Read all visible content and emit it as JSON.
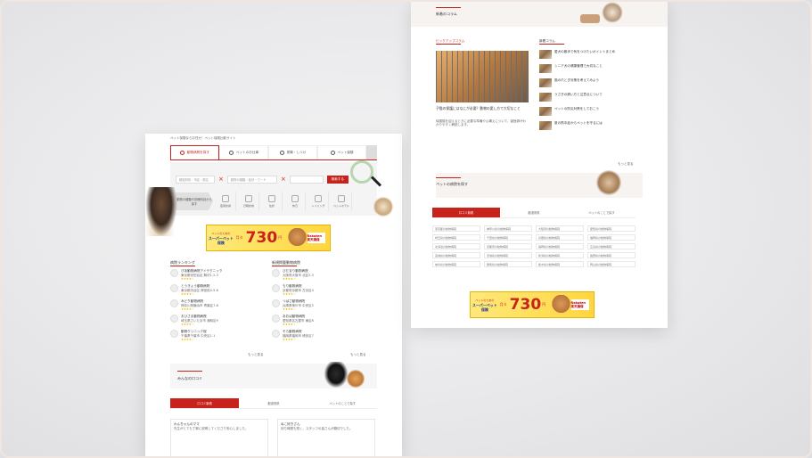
{
  "left_page": {
    "breadcrumb": "ペット保険ならお任せ！ペット保険比較サイト",
    "tabs": [
      {
        "label": "動物病院を探す",
        "icon": "search-icon"
      },
      {
        "label": "ペットのお仕事",
        "icon": "paw-icon"
      },
      {
        "label": "飼育・しつけ",
        "icon": "pencil-icon"
      },
      {
        "label": "ペット保険",
        "icon": "shield-icon"
      }
    ],
    "search": {
      "area_placeholder": "都道府県・市区・駅名",
      "type_placeholder": "動物の種類・症状・ワード",
      "button": "検索する"
    },
    "category_lead": "動物の種類や診療科目から探す",
    "categories": [
      "夜間診療",
      "日曜診療",
      "往診",
      "休日",
      "トリミング",
      "ペットホテル"
    ],
    "banner": {
      "line1": "ペットのための",
      "line2": "スーパーペット保険",
      "price": "730",
      "yen": "円",
      "sub": "月々",
      "partner": "Rakuten 楽天損保"
    },
    "ranking_title": "病院ランキング",
    "ranking_items": [
      {
        "name": "ぴあ動物病院アイテクニック",
        "desc": "東京都世田谷区 駒沢1-2-3"
      },
      {
        "name": "とうきょう動物病院",
        "desc": "東京都渋谷区 神宮前4-5-6"
      },
      {
        "name": "みどり動物病院",
        "desc": "神奈川県横浜市 青葉区7-8"
      },
      {
        "name": "おひさま動物病院",
        "desc": "埼玉県さいたま市 浦和区9"
      },
      {
        "name": "動物クリニック桜",
        "desc": "千葉県千葉市 中央区1-1"
      }
    ],
    "new_title": "新規掲載動物病院",
    "new_items": [
      {
        "name": "ひだまり動物病院",
        "desc": "大阪府大阪市 北区2-3"
      },
      {
        "name": "もり動物病院",
        "desc": "京都府京都市 左京区4"
      },
      {
        "name": "つばさ動物病院",
        "desc": "兵庫県神戸市 中央区5"
      },
      {
        "name": "あおば動物病院",
        "desc": "愛知県名古屋市 東区6"
      },
      {
        "name": "そら動物病院",
        "desc": "福岡県福岡市 博多区7"
      }
    ],
    "stars": "★★★★☆",
    "more": "もっと見る",
    "section_title": "みんなの口コミ",
    "switch": [
      "口コミ新着",
      "都道府県",
      "ペットのことで探す"
    ],
    "reviews": [
      {
        "name": "わんちゃんのママ",
        "text": "先生がとても丁寧に説明してくださり安心しました。"
      },
      {
        "name": "ねこ好きさん",
        "text": "待ち時間も短く、スタッフの皆さんが親切でした。"
      }
    ]
  },
  "right_page": {
    "top_label": "新着のコラム",
    "feature_label": "ピックアップコラム",
    "feature_title": "子猫の保護にはなにが必要？動物の愛し方で大切なこと",
    "feature_body": "保護猫を迎えるときに必要な準備や心構えについて、獣医師がわかりやすく解説します。",
    "new_column_label": "新着コラム",
    "columns": [
      "愛犬の散歩で気をつけたいポイントまとめ",
      "シニア犬の健康管理で大切なこと",
      "猫の爪とぎ対策を考えてみよう",
      "うさぎの飼い方と注意点について",
      "ペットの防災対策をしておこう",
      "夏の熱中症からペットを守るには"
    ],
    "more": "もっと見る",
    "pref_label": "ペットの病院を探す",
    "switch": [
      "口コミ新着",
      "都道府県",
      "ペットのことで探す"
    ],
    "prefectures": [
      "東京都の動物病院",
      "神奈川県の動物病院",
      "大阪府の動物病院",
      "愛知県の動物病院",
      "埼玉県の動物病院",
      "千葉県の動物病院",
      "兵庫県の動物病院",
      "福岡県の動物病院",
      "北海道の動物病院",
      "京都府の動物病院",
      "静岡県の動物病院",
      "広島県の動物病院",
      "宮城県の動物病院",
      "茨城県の動物病院",
      "新潟県の動物病院",
      "長野県の動物病院",
      "岐阜県の動物病院",
      "群馬県の動物病院",
      "栃木県の動物病院",
      "岡山県の動物病院"
    ]
  }
}
